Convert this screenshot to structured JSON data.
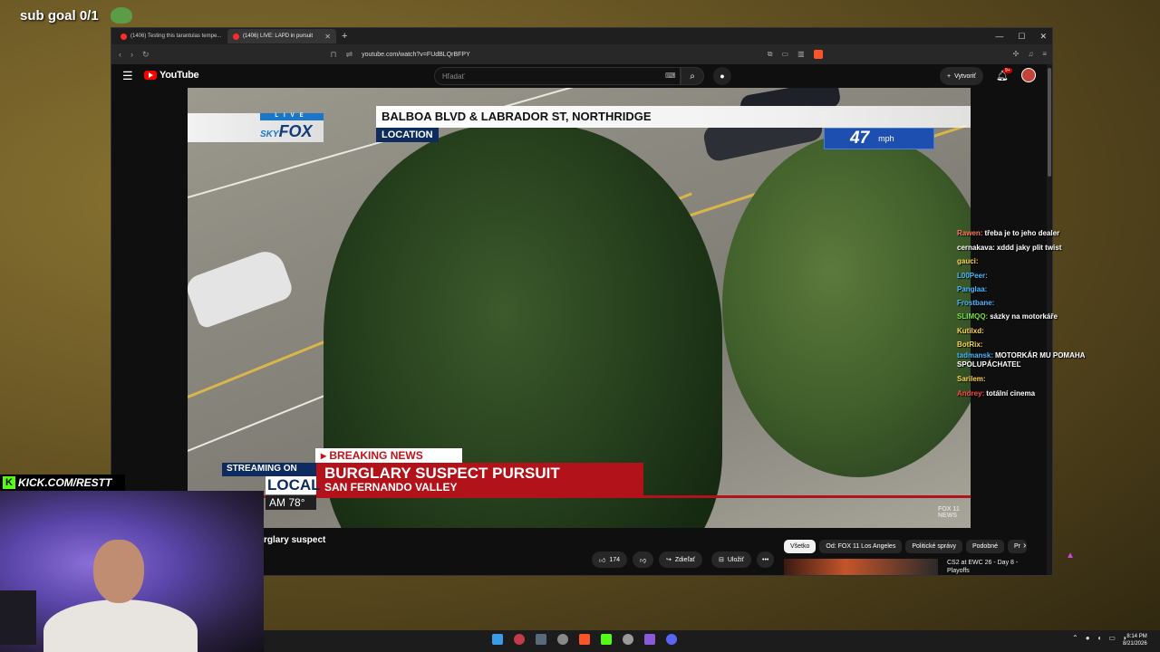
{
  "overlay": {
    "sub_goal": "sub goal 0/1"
  },
  "browser": {
    "tabs": [
      {
        "label": "(1406) Testing this tarantulas tempe..."
      },
      {
        "label": "(1406) LIVE: LAPD in pursuit"
      }
    ],
    "url": "youtube.com/watch?v=FUdBLQrBFPY"
  },
  "youtube": {
    "logo": "YouTube",
    "search_placeholder": "Hľadať",
    "create_label": "Vytvoriť",
    "notif_badge": "9+"
  },
  "video": {
    "location_text": "BALBOA BLVD & LABRADOR ST, NORTHRIDGE",
    "location_label": "LOCATION",
    "speed_value": "47",
    "speed_unit": "mph",
    "skyfox_live": "LIVE",
    "skyfox_sky": "SKY",
    "skyfox_fox": "FOX",
    "breaking_tag": "BREAKING NEWS",
    "headline": "BURGLARY SUSPECT PURSUIT",
    "subheadline": "SAN FERNANDO VALLEY",
    "streaming_on": "STREAMING ON",
    "local": "LOCAL",
    "temp_time": "AM",
    "temp_value": "78°",
    "corner_logo": "FOX 11 NEWS"
  },
  "below_video": {
    "title_fragment": "rglary suspect",
    "like_count": "174",
    "share_label": "Zdieľať",
    "save_label": "Uložiť",
    "chips": [
      "Všetko",
      "Od: FOX 11 Los Angeles",
      "Politické správy",
      "Podobné",
      "Pr"
    ],
    "rec_title": "CS2 at EWC 26 - Day 8 - Playoffs"
  },
  "chat": [
    {
      "user": "Rawen:",
      "msg": "třeba je to jeho dealer",
      "color": "#ff7a5c"
    },
    {
      "user": "cernakava:",
      "msg": "xddd jaky plit twist",
      "color": "#ffffff"
    },
    {
      "user": "gauci:",
      "msg": "",
      "color": "#ffd54a"
    },
    {
      "user": "L00Peer:",
      "msg": "",
      "color": "#4ab8ff"
    },
    {
      "user": "Panglaa:",
      "msg": "",
      "color": "#4ab8ff"
    },
    {
      "user": "Frostbane:",
      "msg": "",
      "color": "#4ab8ff"
    },
    {
      "user": "SLIMQQ:",
      "msg": "sázky na motorkáře",
      "color": "#7ae04a"
    },
    {
      "user": "Kutilxd:",
      "msg": "",
      "color": "#ffd54a"
    },
    {
      "user": "BotRix:",
      "msg": "",
      "color": "#ffd54a"
    },
    {
      "user": "tadmansk:",
      "msg": "MOTORKÁR MU POMAHA SPOLUPÁCHATEĽ",
      "color": "#4ab8ff"
    },
    {
      "user": "Sarilem:",
      "msg": "",
      "color": "#ffd54a"
    },
    {
      "user": "Andrey:",
      "msg": "totální cinema",
      "color": "#ff4a4a"
    }
  ],
  "webcam": {
    "kick_url": "KICK.COM/RESTT"
  },
  "taskbar": {
    "time": "8:14 PM",
    "date": "8/21/2026"
  }
}
